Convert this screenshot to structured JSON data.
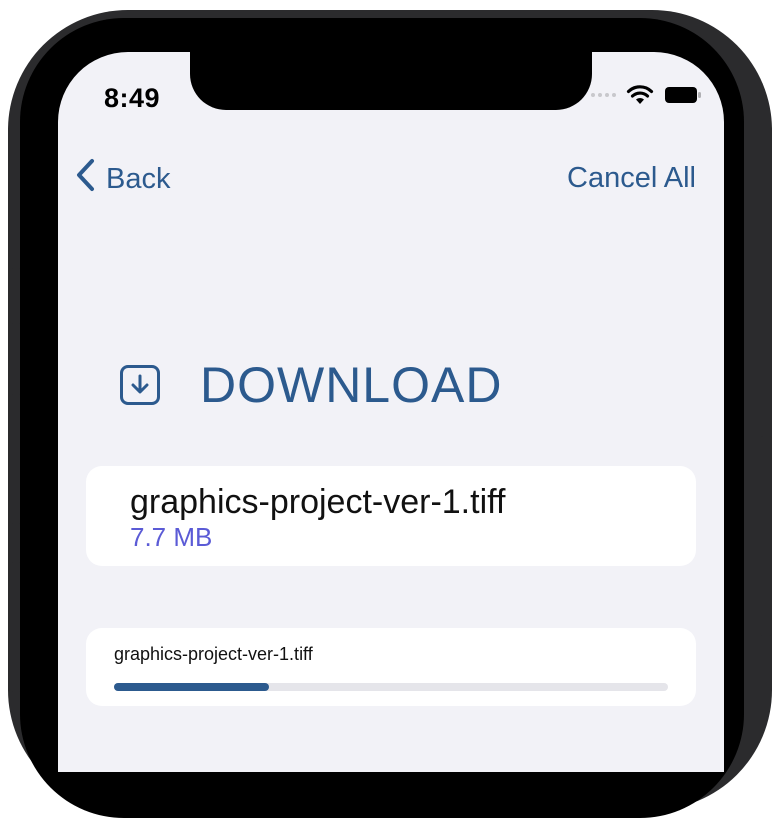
{
  "status_bar": {
    "time": "8:49"
  },
  "nav": {
    "back_label": "Back",
    "cancel_all_label": "Cancel All"
  },
  "header": {
    "title": "DOWNLOAD",
    "icon": "download-icon"
  },
  "file": {
    "name": "graphics-project-ver-1.tiff",
    "size": "7.7 MB"
  },
  "download_progress": {
    "file_name": "graphics-project-ver-1.tiff",
    "progress_fraction": 0.28
  },
  "colors": {
    "accent": "#2c5a8e",
    "size_text": "#5b5bd6",
    "screen_bg": "#f2f2f7"
  }
}
